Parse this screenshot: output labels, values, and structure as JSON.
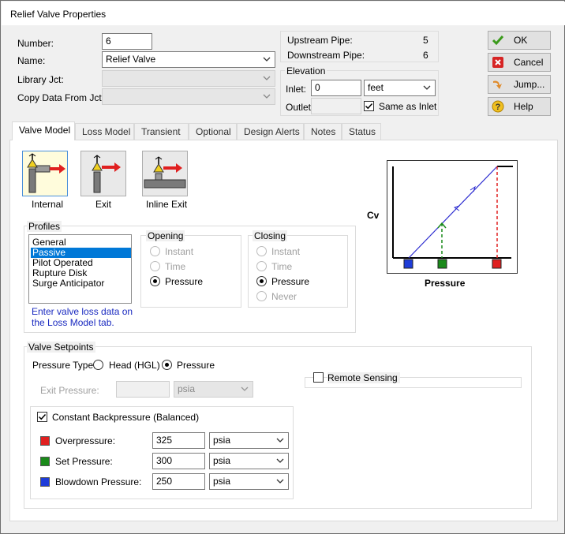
{
  "window": {
    "title": "Relief Valve Properties"
  },
  "fields": {
    "number_label": "Number:",
    "number_value": "6",
    "name_label": "Name:",
    "name_value": "Relief Valve",
    "library_label": "Library Jct:",
    "library_value": "",
    "copy_label": "Copy Data From Jct...",
    "copy_value": ""
  },
  "pipes": {
    "upstream_label": "Upstream Pipe:",
    "upstream_value": "5",
    "downstream_label": "Downstream Pipe:",
    "downstream_value": "6"
  },
  "elevation": {
    "title": "Elevation",
    "inlet_label": "Inlet:",
    "inlet_value": "0",
    "inlet_unit": "feet",
    "outlet_label": "Outlet:",
    "outlet_value": "",
    "same_as_inlet_label": "Same as Inlet",
    "same_as_inlet_checked": true
  },
  "buttons": {
    "ok": "OK",
    "cancel": "Cancel",
    "jump": "Jump...",
    "help": "Help"
  },
  "tabs": [
    {
      "label": "Valve Model",
      "active": true
    },
    {
      "label": "Loss Model"
    },
    {
      "label": "Transient"
    },
    {
      "label": "Optional"
    },
    {
      "label": "Design Alerts"
    },
    {
      "label": "Notes"
    },
    {
      "label": "Status"
    }
  ],
  "valve_types": [
    {
      "label": "Internal",
      "selected": true
    },
    {
      "label": "Exit"
    },
    {
      "label": "Inline Exit"
    }
  ],
  "profiles": {
    "title": "Profiles",
    "items": [
      "General",
      "Passive",
      "Pilot Operated",
      "Rupture Disk",
      "Surge Anticipator"
    ],
    "selected": "Passive",
    "note": "Enter valve loss data on the Loss Model tab."
  },
  "opening": {
    "title": "Opening",
    "options": [
      "Instant",
      "Time",
      "Pressure"
    ],
    "selected": "Pressure"
  },
  "closing": {
    "title": "Closing",
    "options": [
      "Instant",
      "Time",
      "Pressure",
      "Never"
    ],
    "selected": "Pressure"
  },
  "graph": {
    "y_label": "Cv",
    "x_label": "Pressure",
    "colors": {
      "blowdown": "#1e3cd8",
      "set": "#1a8a1a",
      "over": "#e02020",
      "line": "#2b2bd0"
    }
  },
  "setpoints": {
    "title": "Valve Setpoints",
    "pressure_type_label": "Pressure Type:",
    "pt_options": [
      "Head (HGL)",
      "Pressure"
    ],
    "pt_selected": "Pressure",
    "exit_pressure_label": "Exit Pressure:",
    "exit_pressure_value": "",
    "exit_pressure_unit": "psia",
    "remote_sensing_label": "Remote Sensing",
    "remote_sensing_checked": false,
    "constant_backpressure_label": "Constant Backpressure (Balanced)",
    "constant_backpressure_checked": true,
    "rows": [
      {
        "label": "Overpressure:",
        "value": "325",
        "unit": "psia",
        "color": "#e02020"
      },
      {
        "label": "Set Pressure:",
        "value": "300",
        "unit": "psia",
        "color": "#1a8a1a"
      },
      {
        "label": "Blowdown Pressure:",
        "value": "250",
        "unit": "psia",
        "color": "#1e3cd8"
      }
    ]
  }
}
